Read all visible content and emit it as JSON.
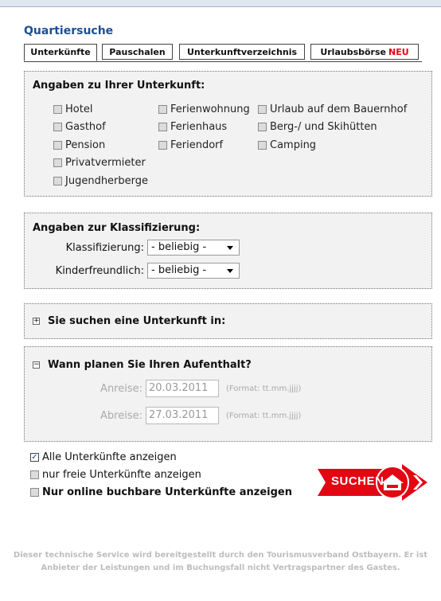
{
  "page": {
    "title": "Quartiersuche"
  },
  "tabs": [
    {
      "label": "Unterkünfte"
    },
    {
      "label": "Pauschalen"
    },
    {
      "label": "Unterkunftverzeichnis"
    },
    {
      "label": "Urlaubsbörse",
      "badge": "NEU"
    }
  ],
  "unterkunft": {
    "heading": "Angaben zu Ihrer Unterkunft:",
    "col1": [
      "Hotel",
      "Gasthof",
      "Pension",
      "Privatvermieter",
      "Jugendherberge"
    ],
    "col2": [
      "Ferienwohnung",
      "Ferienhaus",
      "Feriendorf"
    ],
    "col3": [
      "Urlaub auf dem Bauernhof",
      "Berg-/ und Skihütten",
      "Camping"
    ]
  },
  "klassifizierung": {
    "heading": "Angaben zur Klassifizierung:",
    "klass_label": "Klassifizierung:",
    "klass_value": "- beliebig -",
    "kinder_label": "Kinderfreundlich:",
    "kinder_value": "- beliebig -"
  },
  "ort": {
    "toggle": "+",
    "heading": "Sie suchen eine Unterkunft in:"
  },
  "aufenthalt": {
    "toggle": "−",
    "heading": "Wann planen Sie Ihren Aufenthalt?",
    "anreise_label": "Anreise:",
    "anreise_value": "20.03.2011",
    "abreise_label": "Abreise:",
    "abreise_value": "27.03.2011",
    "format_hint": "(Format: tt.mm.jjjj)"
  },
  "options": [
    {
      "label": "Alle Unterkünfte anzeigen",
      "checked": true
    },
    {
      "label": "nur freie Unterkünfte anzeigen",
      "checked": false
    },
    {
      "label": "Nur online buchbare Unterkünfte anzeigen",
      "checked": false
    }
  ],
  "search_button": {
    "label": "SUCHEN",
    "color": "#e30613"
  },
  "footer": {
    "line1": "Dieser technische Service wird bereitgestellt durch den Tourismusverband Ostbayern. Er ist",
    "line2": "Anbieter der Leistungen und im Buchungsfall nicht Vertragspartner des Gastes."
  },
  "colors": {
    "title": "#1d4f91",
    "panel_bg": "#f2f2f2",
    "accent_red": "#e30613"
  }
}
